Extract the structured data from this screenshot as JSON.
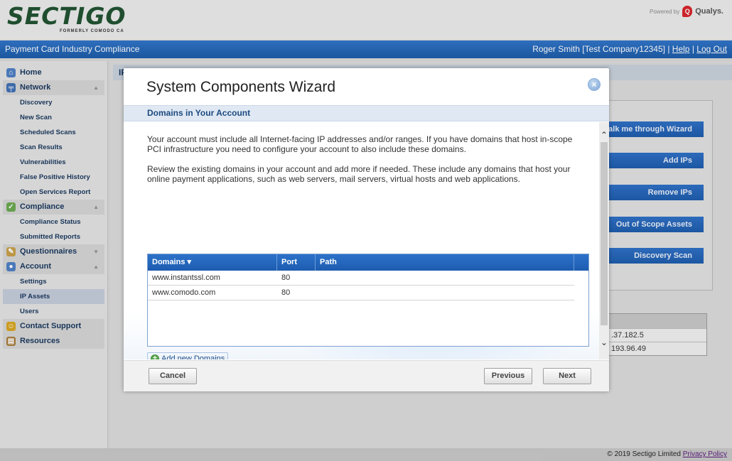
{
  "brand": {
    "logo_text": "SECTIGO",
    "logo_subtitle": "FORMERLY COMODO CA",
    "powered_by": "Powered by",
    "partner": "Qualys."
  },
  "header": {
    "app_title": "Payment Card Industry Compliance",
    "user": "Roger Smith [Test Company12345]",
    "separator": "|",
    "help_link": "Help",
    "logout_link": "Log Out"
  },
  "sidebar": {
    "items": [
      {
        "label": "Home",
        "level": "top",
        "icon": "home-icon"
      },
      {
        "label": "Network",
        "level": "top",
        "icon": "network-icon",
        "expanded": true
      },
      {
        "label": "Discovery",
        "level": "sub"
      },
      {
        "label": "New Scan",
        "level": "sub"
      },
      {
        "label": "Scheduled Scans",
        "level": "sub"
      },
      {
        "label": "Scan Results",
        "level": "sub"
      },
      {
        "label": "Vulnerabilities",
        "level": "sub"
      },
      {
        "label": "False Positive History",
        "level": "sub"
      },
      {
        "label": "Open Services Report",
        "level": "sub"
      },
      {
        "label": "Compliance",
        "level": "top",
        "icon": "compliance-icon",
        "expanded": true
      },
      {
        "label": "Compliance Status",
        "level": "sub"
      },
      {
        "label": "Submitted Reports",
        "level": "sub"
      },
      {
        "label": "Questionnaires",
        "level": "top",
        "icon": "questionnaire-icon",
        "expanded": false
      },
      {
        "label": "Account",
        "level": "top",
        "icon": "account-icon",
        "expanded": true
      },
      {
        "label": "Settings",
        "level": "sub"
      },
      {
        "label": "IP Assets",
        "level": "sub",
        "active": true
      },
      {
        "label": "Users",
        "level": "sub"
      },
      {
        "label": "Contact Support",
        "level": "top",
        "icon": "support-icon"
      },
      {
        "label": "Resources",
        "level": "top",
        "icon": "resources-icon"
      }
    ]
  },
  "background": {
    "page_heading": "IP",
    "buttons": [
      "alk me through Wizard",
      "Add IPs",
      "Remove IPs",
      "Out of Scope Assets",
      "Discovery Scan"
    ],
    "ip_rows": [
      ".37.182.5",
      "193.96.49"
    ]
  },
  "wizard": {
    "title": "System Components Wizard",
    "close_symbol": "×",
    "section_title": "Domains in Your Account",
    "paragraph1": "Your account must include all Internet-facing IP addresses and/or ranges. If you have domains that host in-scope PCI infrastructure you need to configure your account to also include these domains.",
    "paragraph2": "Review the existing domains in your account and add more if needed. These include any domains that host your online payment applications, such as web servers, mail servers, virtual hosts and web applications.",
    "table": {
      "columns": [
        "Domains ▾",
        "Port",
        "Path"
      ],
      "rows": [
        {
          "domain": "www.instantssl.com",
          "port": "80",
          "path": ""
        },
        {
          "domain": "www.comodo.com",
          "port": "80",
          "path": ""
        }
      ]
    },
    "add_button": "Add new Domains",
    "textarea_value": "",
    "buttons": {
      "cancel": "Cancel",
      "previous": "Previous",
      "next": "Next"
    }
  },
  "footer": {
    "copyright": "© 2019 Sectigo Limited",
    "privacy_link": "Privacy Policy"
  },
  "colors": {
    "header_blue": "#1f64b8",
    "brand_green": "#1f5130",
    "table_header": "#2467bd",
    "section_bar": "#dfe8f3"
  }
}
